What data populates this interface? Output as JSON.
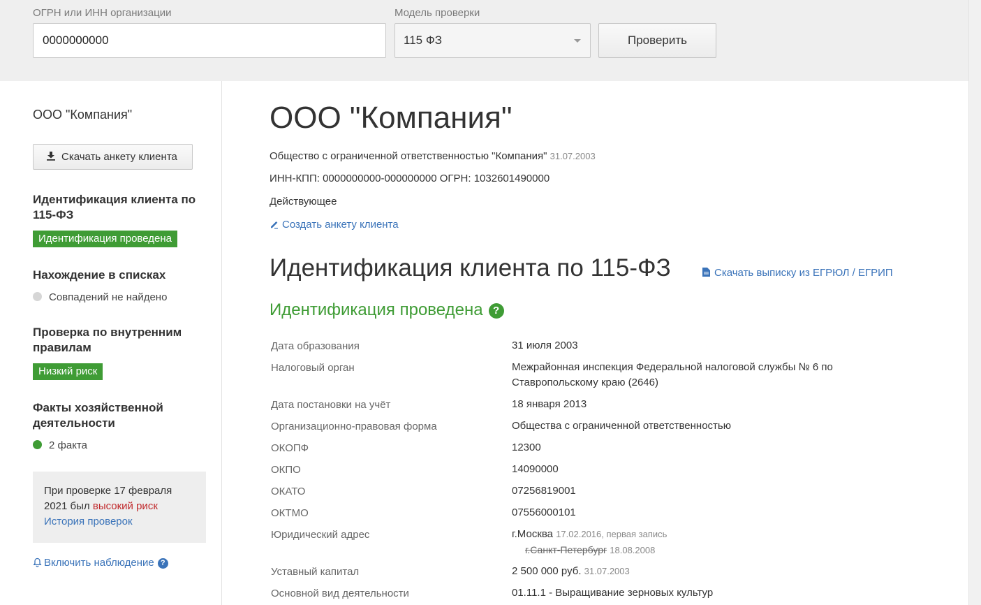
{
  "search": {
    "inn_label": "ОГРН или ИНН организации",
    "inn_value": "0000000000",
    "model_label": "Модель проверки",
    "model_value": "115 ФЗ",
    "check_button": "Проверить"
  },
  "sidebar": {
    "company_name": "ООО \"Компания\"",
    "download_button": "Скачать анкету клиента",
    "identification_heading": "Идентификация клиента по 115-ФЗ",
    "identification_badge": "Идентификация проведена",
    "lists_heading": "Нахождение в списках",
    "lists_status": "Совпадений не найдено",
    "rules_heading": "Проверка по внутренним правилам",
    "rules_badge": "Низкий риск",
    "facts_heading": "Факты хозяйственной деятельности",
    "facts_status": "2 факта",
    "history_text_1": "При проверке 17 февраля 2021 был",
    "history_risk": "высокий риск",
    "history_link": "История проверок",
    "watch_link": "Включить наблюдение",
    "help_mark": "?"
  },
  "colors": {
    "accent_green": "#3f9c35",
    "link_blue": "#3a73b9",
    "risk_red": "#c0292c",
    "dot_grey": "#d6d6d6"
  },
  "main": {
    "title": "ООО \"Компания\"",
    "full_name": "Общество с ограниченной ответственностью \"Компания\"",
    "full_name_date": "31.07.2003",
    "requisites": "ИНН-КПП: 0000000000-000000000 ОГРН: 1032601490000",
    "status": "Действующее",
    "create_link": "Создать анкету клиента",
    "section_title": "Идентификация клиента по 115-ФЗ",
    "extract_link": "Скачать выписку из ЕГРЮЛ / ЕГРИП",
    "ident_status": "Идентификация проведена",
    "help_mark": "?"
  },
  "details": {
    "formation_date": {
      "label": "Дата образования",
      "value": "31 июля 2003"
    },
    "tax_authority": {
      "label": "Налоговый орган",
      "value": "Межрайонная инспекция Федеральной налоговой службы № 6 по Ставропольскому краю (2646)"
    },
    "registration_date": {
      "label": "Дата постановки на учёт",
      "value": "18 января 2013"
    },
    "legal_form": {
      "label": "Организационно-правовая форма",
      "value": "Общества с ограниченной ответственностью"
    },
    "okopf": {
      "label": "ОКОПФ",
      "value": "12300"
    },
    "okpo": {
      "label": "ОКПО",
      "value": "14090000"
    },
    "okato": {
      "label": "ОКАТО",
      "value": "07256819001"
    },
    "oktmo": {
      "label": "ОКТМО",
      "value": "07556000101"
    },
    "address": {
      "label": "Юридический адрес",
      "value": "г.Москва",
      "value_note": "17.02.2016, первая запись",
      "old_value": "г.Санкт-Петербург",
      "old_date": "18.08.2008"
    },
    "capital": {
      "label": "Уставный капитал",
      "value": "2 500 000 руб.",
      "date": "31.07.2003"
    },
    "activity": {
      "label": "Основной вид деятельности",
      "value": "01.11.1 - Выращивание зерновых культур"
    }
  }
}
